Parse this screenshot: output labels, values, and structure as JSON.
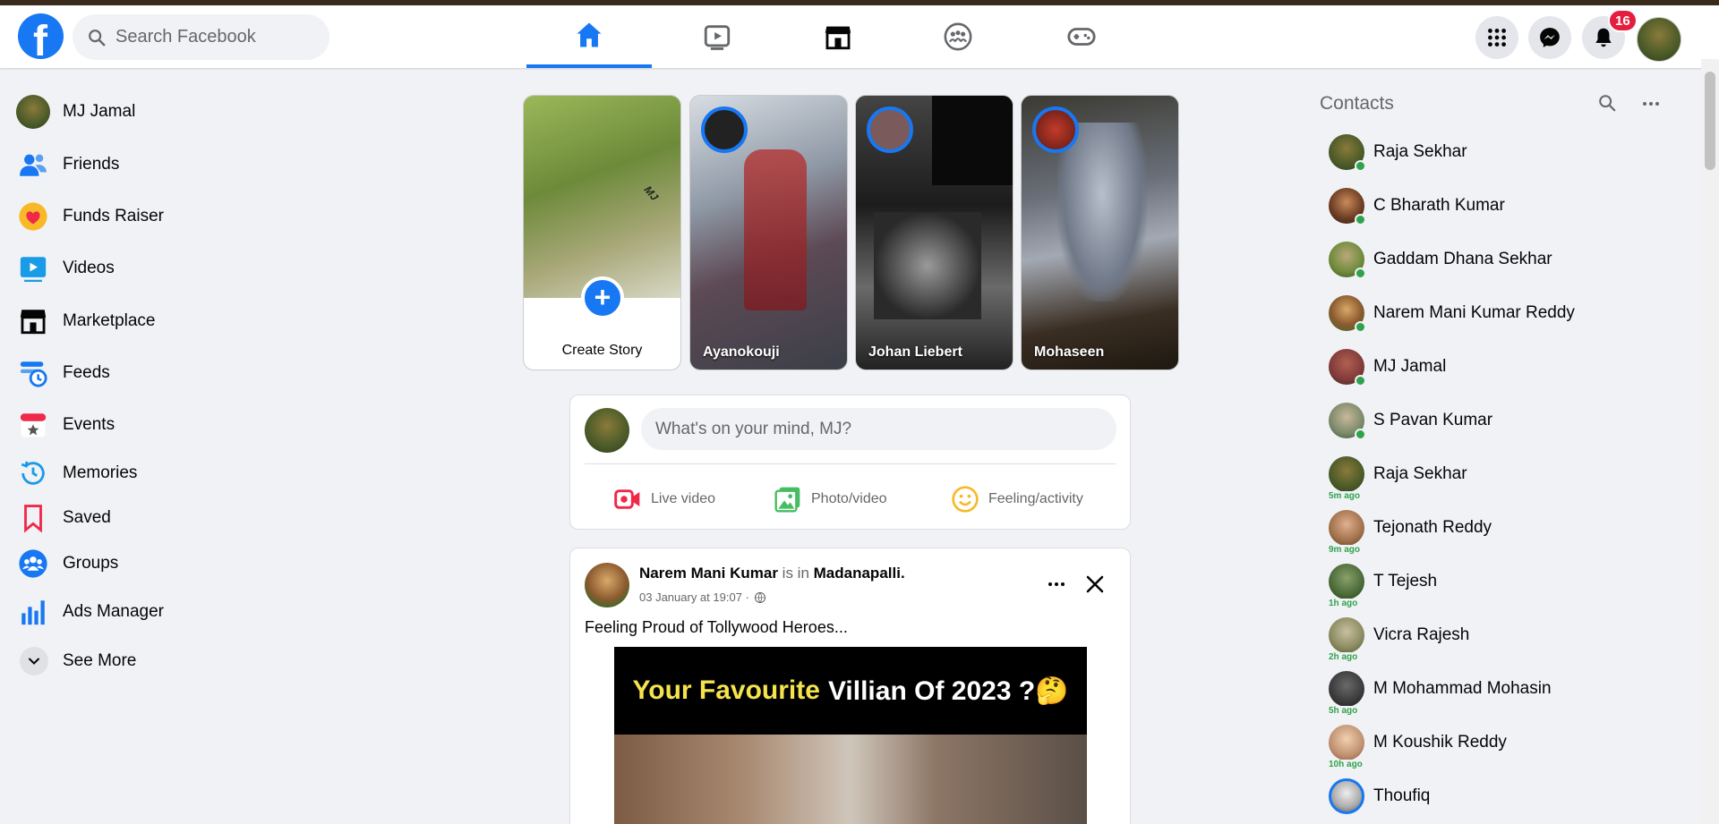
{
  "colors": {
    "accent": "#1877f2",
    "badge": "#e41e3f",
    "online": "#31a24c",
    "bg": "#f0f2f5"
  },
  "header": {
    "logo_icon": "facebook-logo",
    "logo_letter": "f",
    "search_placeholder": "Search Facebook",
    "nav_tabs": [
      {
        "name": "home",
        "icon": "home-icon",
        "active": true
      },
      {
        "name": "watch",
        "icon": "video-icon",
        "active": false
      },
      {
        "name": "marketplace",
        "icon": "store-icon",
        "active": false
      },
      {
        "name": "groups",
        "icon": "groups-icon",
        "active": false
      },
      {
        "name": "gaming",
        "icon": "gamepad-icon",
        "active": false
      }
    ],
    "notification_count": "16"
  },
  "sidebar": {
    "items": [
      {
        "label": "MJ Jamal",
        "icon": "profile-avatar"
      },
      {
        "label": "Friends",
        "icon": "friends-icon"
      },
      {
        "label": "Funds Raiser",
        "icon": "heart-icon"
      },
      {
        "label": "Videos",
        "icon": "video-icon"
      },
      {
        "label": "Marketplace",
        "icon": "store-icon"
      },
      {
        "label": "Feeds",
        "icon": "feeds-icon"
      },
      {
        "label": "Events",
        "icon": "calendar-star-icon"
      },
      {
        "label": "Memories",
        "icon": "clock-icon"
      },
      {
        "label": "Saved",
        "icon": "bookmark-icon"
      },
      {
        "label": "Groups",
        "icon": "groups-icon"
      },
      {
        "label": "Ads Manager",
        "icon": "bar-chart-icon"
      }
    ],
    "see_more": "See More"
  },
  "stories": {
    "create_label": "Create Story",
    "create_watermark": "MJ",
    "items": [
      {
        "name": "Ayanokouji"
      },
      {
        "name": "Johan Liebert"
      },
      {
        "name": "Mohaseen"
      }
    ]
  },
  "composer": {
    "placeholder": "What's on your mind, MJ?",
    "actions": [
      {
        "label": "Live video",
        "icon": "live-video-icon"
      },
      {
        "label": "Photo/video",
        "icon": "photo-icon"
      },
      {
        "label": "Feeling/activity",
        "icon": "smiley-icon"
      }
    ]
  },
  "post": {
    "author": "Narem Mani Kumar",
    "verb": "is in",
    "place": "Madanapalli.",
    "time": "03 January at 19:07 ·",
    "text": "Feeling Proud of Tollywood Heroes...",
    "image_headline_highlight": "Your Favourite",
    "image_headline_rest": "Villian Of 2023 ?🤔"
  },
  "contacts": {
    "title": "Contacts",
    "items": [
      {
        "name": "Raja Sekhar",
        "status": "online",
        "ago": ""
      },
      {
        "name": "C Bharath Kumar",
        "status": "online",
        "ago": ""
      },
      {
        "name": "Gaddam Dhana Sekhar",
        "status": "online",
        "ago": ""
      },
      {
        "name": "Narem Mani Kumar Reddy",
        "status": "online",
        "ago": ""
      },
      {
        "name": "MJ Jamal",
        "status": "online",
        "ago": ""
      },
      {
        "name": "S Pavan Kumar",
        "status": "online",
        "ago": ""
      },
      {
        "name": "Raja Sekhar",
        "status": "away",
        "ago": "5m ago"
      },
      {
        "name": "Tejonath Reddy",
        "status": "away",
        "ago": "9m ago"
      },
      {
        "name": "T Tejesh",
        "status": "away",
        "ago": "1h ago"
      },
      {
        "name": "Vicra Rajesh",
        "status": "away",
        "ago": "2h ago"
      },
      {
        "name": "M Mohammad Mohasin",
        "status": "away",
        "ago": "5h ago"
      },
      {
        "name": "M Koushik Reddy",
        "status": "away",
        "ago": "10h ago"
      },
      {
        "name": "Thoufiq",
        "status": "story",
        "ago": ""
      }
    ]
  }
}
